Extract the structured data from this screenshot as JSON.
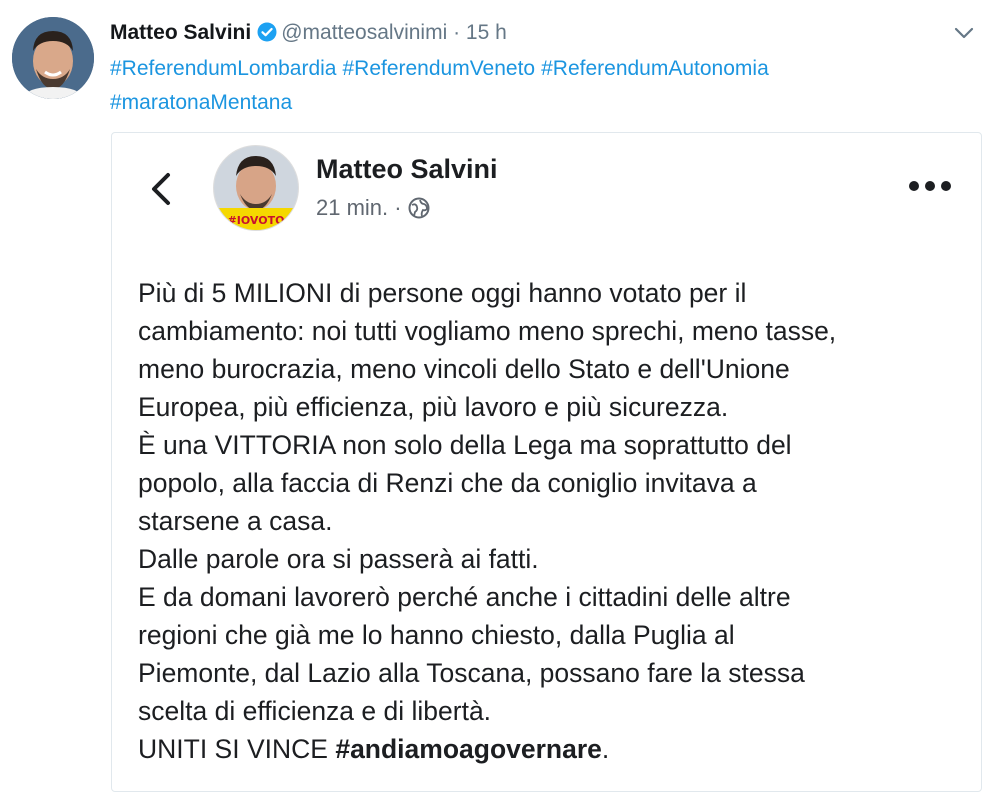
{
  "tweet": {
    "author_name": "Matteo Salvini",
    "handle": "@matteosalvinimi",
    "separator": "·",
    "time": "15 h",
    "hashtags": [
      "#ReferendumLombardia",
      "#ReferendumVeneto",
      "#ReferendumAutonomia",
      "#maratonaMentana"
    ]
  },
  "embedded_post": {
    "author_name": "Matteo Salvini",
    "time": "21 min.",
    "separator": "·",
    "avatar_banner_text": "#IOVOTO",
    "paragraphs": [
      "Più di 5 MILIONI di persone oggi hanno votato per il",
      "cambiamento: noi tutti vogliamo meno sprechi, meno tasse,",
      "meno burocrazia, meno vincoli dello Stato e dell'Unione",
      "Europea, più efficienza, più lavoro e più sicurezza.",
      "È una VITTORIA non solo della Lega ma soprattutto del",
      "popolo, alla faccia di Renzi che da coniglio invitava a",
      "starsene a casa.",
      "Dalle parole ora si passerà ai fatti.",
      "E da domani lavorerò perché anche i cittadini delle altre",
      "regioni che già me lo hanno chiesto, dalla Puglia al",
      "Piemonte, dal Lazio alla Toscana, possano fare la stessa",
      "scelta di efficienza e di libertà."
    ],
    "closing_text": "UNITI SI VINCE",
    "closing_hashtag": "#andiamoagovernare",
    "closing_period": "."
  },
  "colors": {
    "link": "#1b95e0",
    "verified": "#1da1f2",
    "muted": "#657786",
    "card_border": "#e1e8ed"
  },
  "icons": [
    "verified-badge-icon",
    "chevron-down-icon",
    "back-arrow-icon",
    "globe-icon",
    "more-options-icon"
  ]
}
